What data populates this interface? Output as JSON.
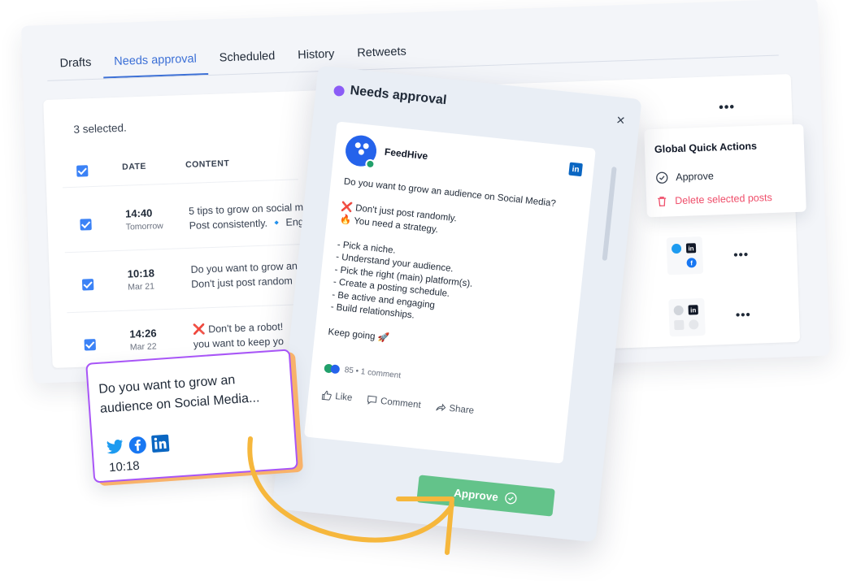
{
  "tabs": [
    "Drafts",
    "Needs approval",
    "Scheduled",
    "History",
    "Retweets"
  ],
  "table": {
    "selected_text": "3 selected.",
    "more": "•••",
    "headers": {
      "date": "DATE",
      "content": "CONTENT"
    },
    "rows": [
      {
        "time": "14:40",
        "day": "Tomorrow",
        "line1": "5 tips to grow on social me",
        "line2": "Post consistently. 🔹 Enga"
      },
      {
        "time": "10:18",
        "day": "Mar 21",
        "line1": "Do you want to grow an",
        "line2": "Don't just post random"
      },
      {
        "time": "14:26",
        "day": "Mar 22",
        "line1": "❌ Don't be a robot! ",
        "line2": "you want to keep yo"
      }
    ]
  },
  "quick_actions": {
    "title": "Global Quick Actions",
    "approve": "Approve",
    "delete": "Delete selected posts"
  },
  "modal": {
    "title": "Needs approval",
    "close": "×",
    "post": {
      "author": "FeedHive",
      "body": "Do you want to grow an audience on Social Media?\n\n❌ Don't just post randomly.\n🔥 You need a strategy.\n\n- Pick a niche.\n- Understand your audience.\n- Pick the right (main) platform(s).\n- Create a posting schedule.\n- Be active and engaging\n- Build relationships.\n\nKeep going 🚀",
      "reactions": "85 • 1 comment",
      "like": "Like",
      "comment": "Comment",
      "share": "Share"
    },
    "approve_label": "Approve"
  },
  "preview": {
    "text": "Do you want to grow an audience on Social Media...",
    "time": "10:18"
  },
  "colors": {
    "accent": "#3b6fd6",
    "approve_green": "#63c38a",
    "delete_red": "#ef4f6b",
    "purple": "#8b5cf6",
    "arrow_yellow": "#f6b73c"
  }
}
